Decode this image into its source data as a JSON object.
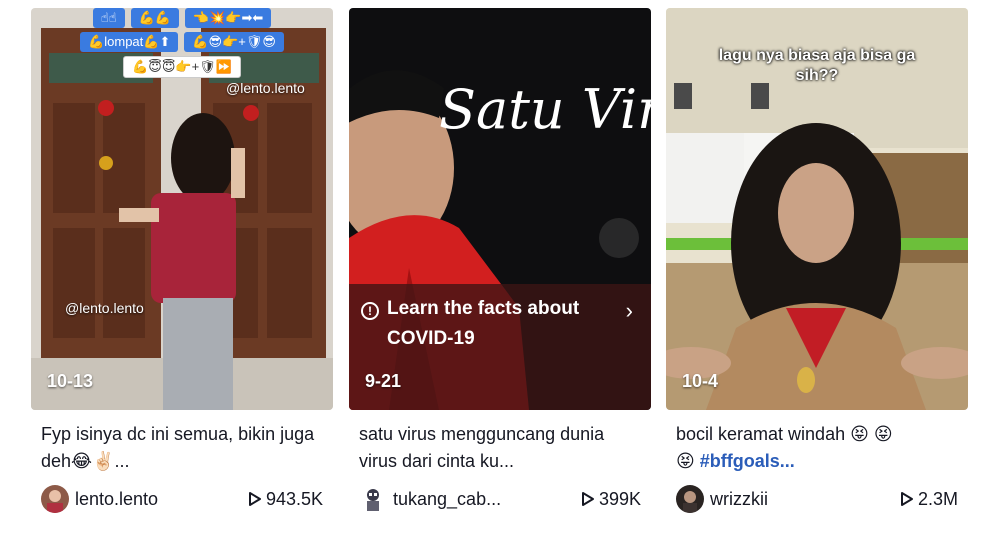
{
  "cards": [
    {
      "date": "10-13",
      "watermark_top": "@lento.lento",
      "watermark_mid": "@lento.lento",
      "stickers_row1": [
        "☝☝",
        "💪💪",
        "👈💥👉➡⬅"
      ],
      "stickers_row2": [
        "💪lompat💪⬆",
        "💪😎👉+🛡😎"
      ],
      "stickers_row3": [
        "💪😇😇👉+🛡⏩"
      ],
      "description": "Fyp isinya dc ini semua, bikin juga deh😂✌🏻...",
      "username": "lento.lento",
      "views": "943.5K"
    },
    {
      "date": "9-21",
      "title_overlay": "Satu Viru",
      "banner_line1": "Learn the facts about",
      "banner_line2": "COVID-19",
      "description": "satu virus mengguncang dunia virus dari cinta ku...",
      "username": "tukang_cab...",
      "views": "399K"
    },
    {
      "date": "10-4",
      "caption_line1": "lagu nya biasa aja bisa ga",
      "caption_line2": "sih??",
      "description_prefix": "bocil keramat windah 😝 😝",
      "description_emoji": "😝 ",
      "description_tag": "#bffgoals...",
      "username": "wrizzkii",
      "views": "2.3M"
    }
  ],
  "colors": {
    "link": "#2b5db9",
    "text": "#161823"
  }
}
